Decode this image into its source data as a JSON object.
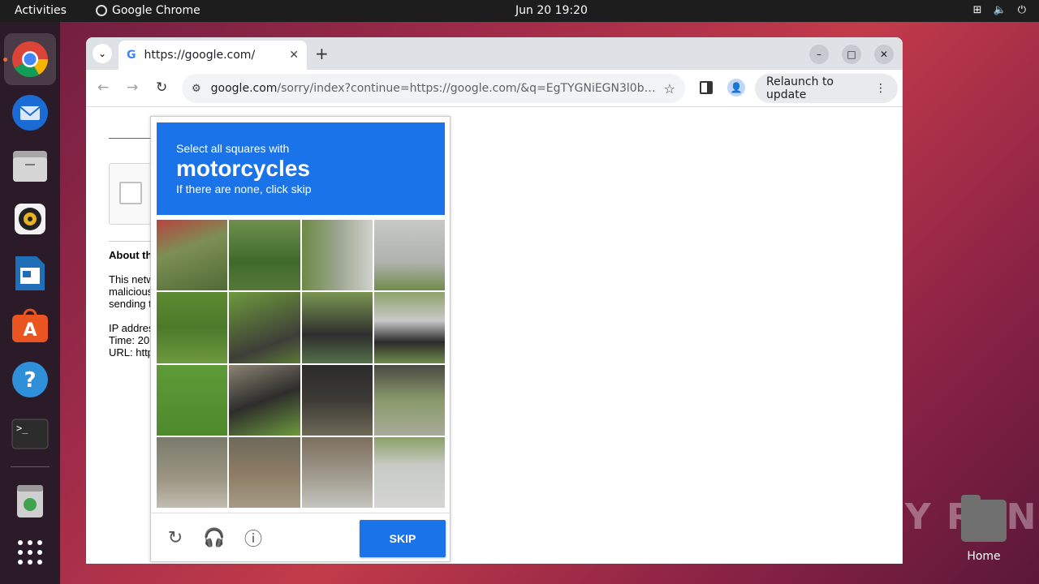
{
  "topbar": {
    "activities": "Activities",
    "app_name": "Google Chrome",
    "clock": "Jun 20  19:20"
  },
  "dock": {
    "items": [
      "chrome-icon",
      "thunderbird-icon",
      "files-icon",
      "rhythmbox-icon",
      "writer-icon",
      "app-center-icon",
      "help-icon",
      "terminal-icon",
      "trash-icon",
      "app-grid-icon"
    ]
  },
  "browser": {
    "tab_title": "https://google.com/",
    "url_host": "google.com",
    "url_path": "/sorry/index?continue=https://google.com/&q=EgTYGNiEGN3l0bMGIjA0...",
    "relaunch": "Relaunch to update"
  },
  "page": {
    "about": "About this page",
    "para1": "This network",
    "para2": "malicious",
    "para3": "sending t",
    "ip": "IP address",
    "time": "Time: 20",
    "url": "URL: http"
  },
  "captcha": {
    "line1": "Select all squares with",
    "target": "motorcycles",
    "line3": "If there are none, click skip",
    "skip": "SKIP"
  },
  "desktop": {
    "home_label": "Home",
    "watermark": "ANY RUN"
  },
  "colors": {
    "captcha_blue": "#1a73e8",
    "ubuntu_orange": "#e95420"
  }
}
